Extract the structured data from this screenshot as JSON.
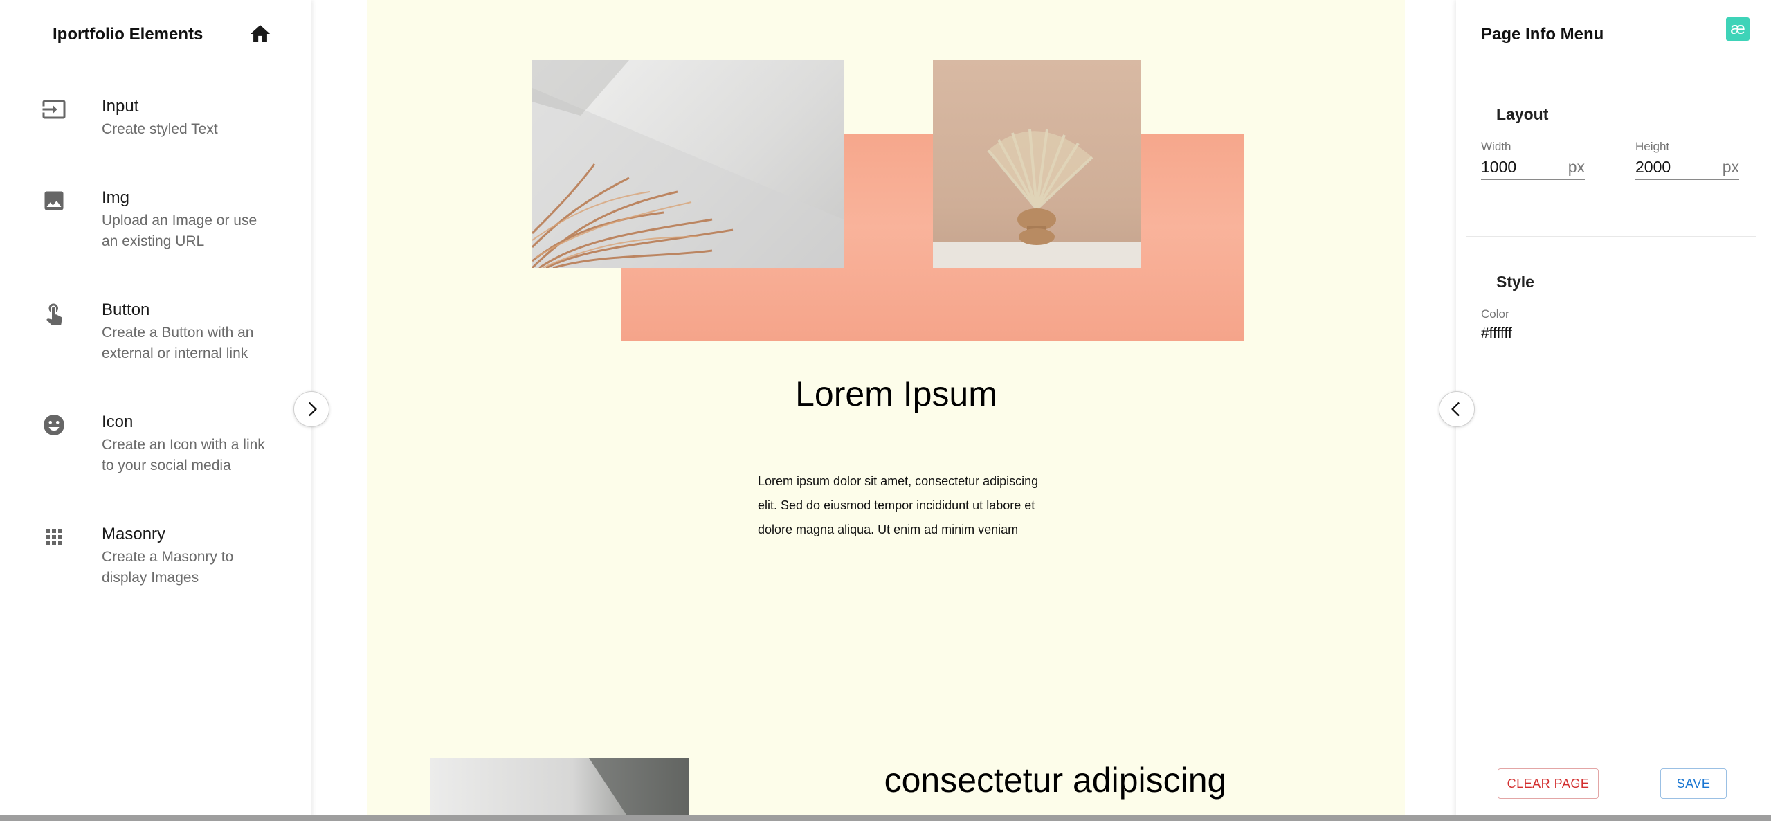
{
  "left_panel": {
    "title": "Iportfolio Elements",
    "items": [
      {
        "title": "Input",
        "description": "Create styled Text",
        "icon": "input-icon"
      },
      {
        "title": "Img",
        "description": "Upload an Image or use an existing URL",
        "icon": "image-icon"
      },
      {
        "title": "Button",
        "description": "Create a Button with an external or internal link",
        "icon": "touch-icon"
      },
      {
        "title": "Icon",
        "description": "Create an Icon with a link to your social media",
        "icon": "smiley-icon"
      },
      {
        "title": "Masonry",
        "description": "Create a Masonry to display Images",
        "icon": "grid-icon"
      }
    ]
  },
  "canvas": {
    "background": "#fdfdea",
    "accent_block_color": "#f6a78c",
    "heading_1": "Lorem Ipsum",
    "paragraph_1": "Lorem ipsum dolor sit amet, consectetur adipiscing elit. Sed do eiusmod tempor incididunt ut labore et dolore magna aliqua. Ut enim ad minim veniam",
    "heading_2": "consectetur adipiscing"
  },
  "right_panel": {
    "title": "Page Info Menu",
    "logo_text": "æ",
    "layout": {
      "title": "Layout",
      "width_label": "Width",
      "width_value": "1000",
      "width_unit": "px",
      "height_label": "Height",
      "height_value": "2000",
      "height_unit": "px"
    },
    "style": {
      "title": "Style",
      "color_label": "Color",
      "color_value": "#ffffff"
    },
    "clear_label": "CLEAR PAGE",
    "save_label": "SAVE"
  }
}
